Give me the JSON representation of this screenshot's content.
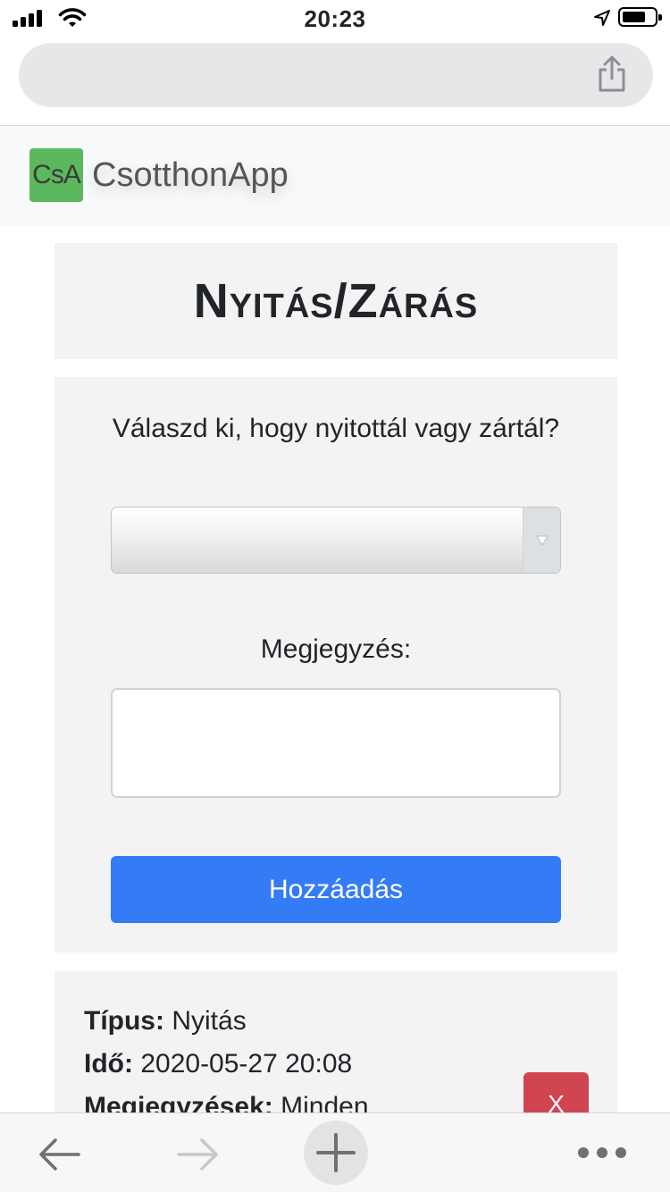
{
  "status_bar": {
    "time": "20:23",
    "icons": [
      "cellular-signal-icon",
      "wifi-icon",
      "location-arrow-icon",
      "battery-icon"
    ]
  },
  "browser": {
    "url": "",
    "share_icon": "share-icon"
  },
  "navbar": {
    "logo_text": "CsA",
    "app_name": "CsotthonApp",
    "logo_color": "#5cb85c"
  },
  "page": {
    "title": "Nyitás/Zárás"
  },
  "form": {
    "question": "Válaszd ki, hogy nyitottál vagy zártál?",
    "select_value": "",
    "note_label": "Megjegyzés:",
    "note_value": "",
    "submit_label": "Hozzáadás",
    "submit_color": "#347cf5"
  },
  "entries": [
    {
      "type_label": "Típus:",
      "type_value": "Nyitás",
      "time_label": "Idő:",
      "time_value": "2020-05-27 20:08",
      "notes_label": "Megjegyzések:",
      "notes_value": "Minden",
      "delete_label": "X",
      "delete_color": "#d04550"
    }
  ],
  "toolbar": {
    "icons": [
      "back-arrow-icon",
      "forward-arrow-icon",
      "plus-icon",
      "more-dots-icon"
    ]
  }
}
